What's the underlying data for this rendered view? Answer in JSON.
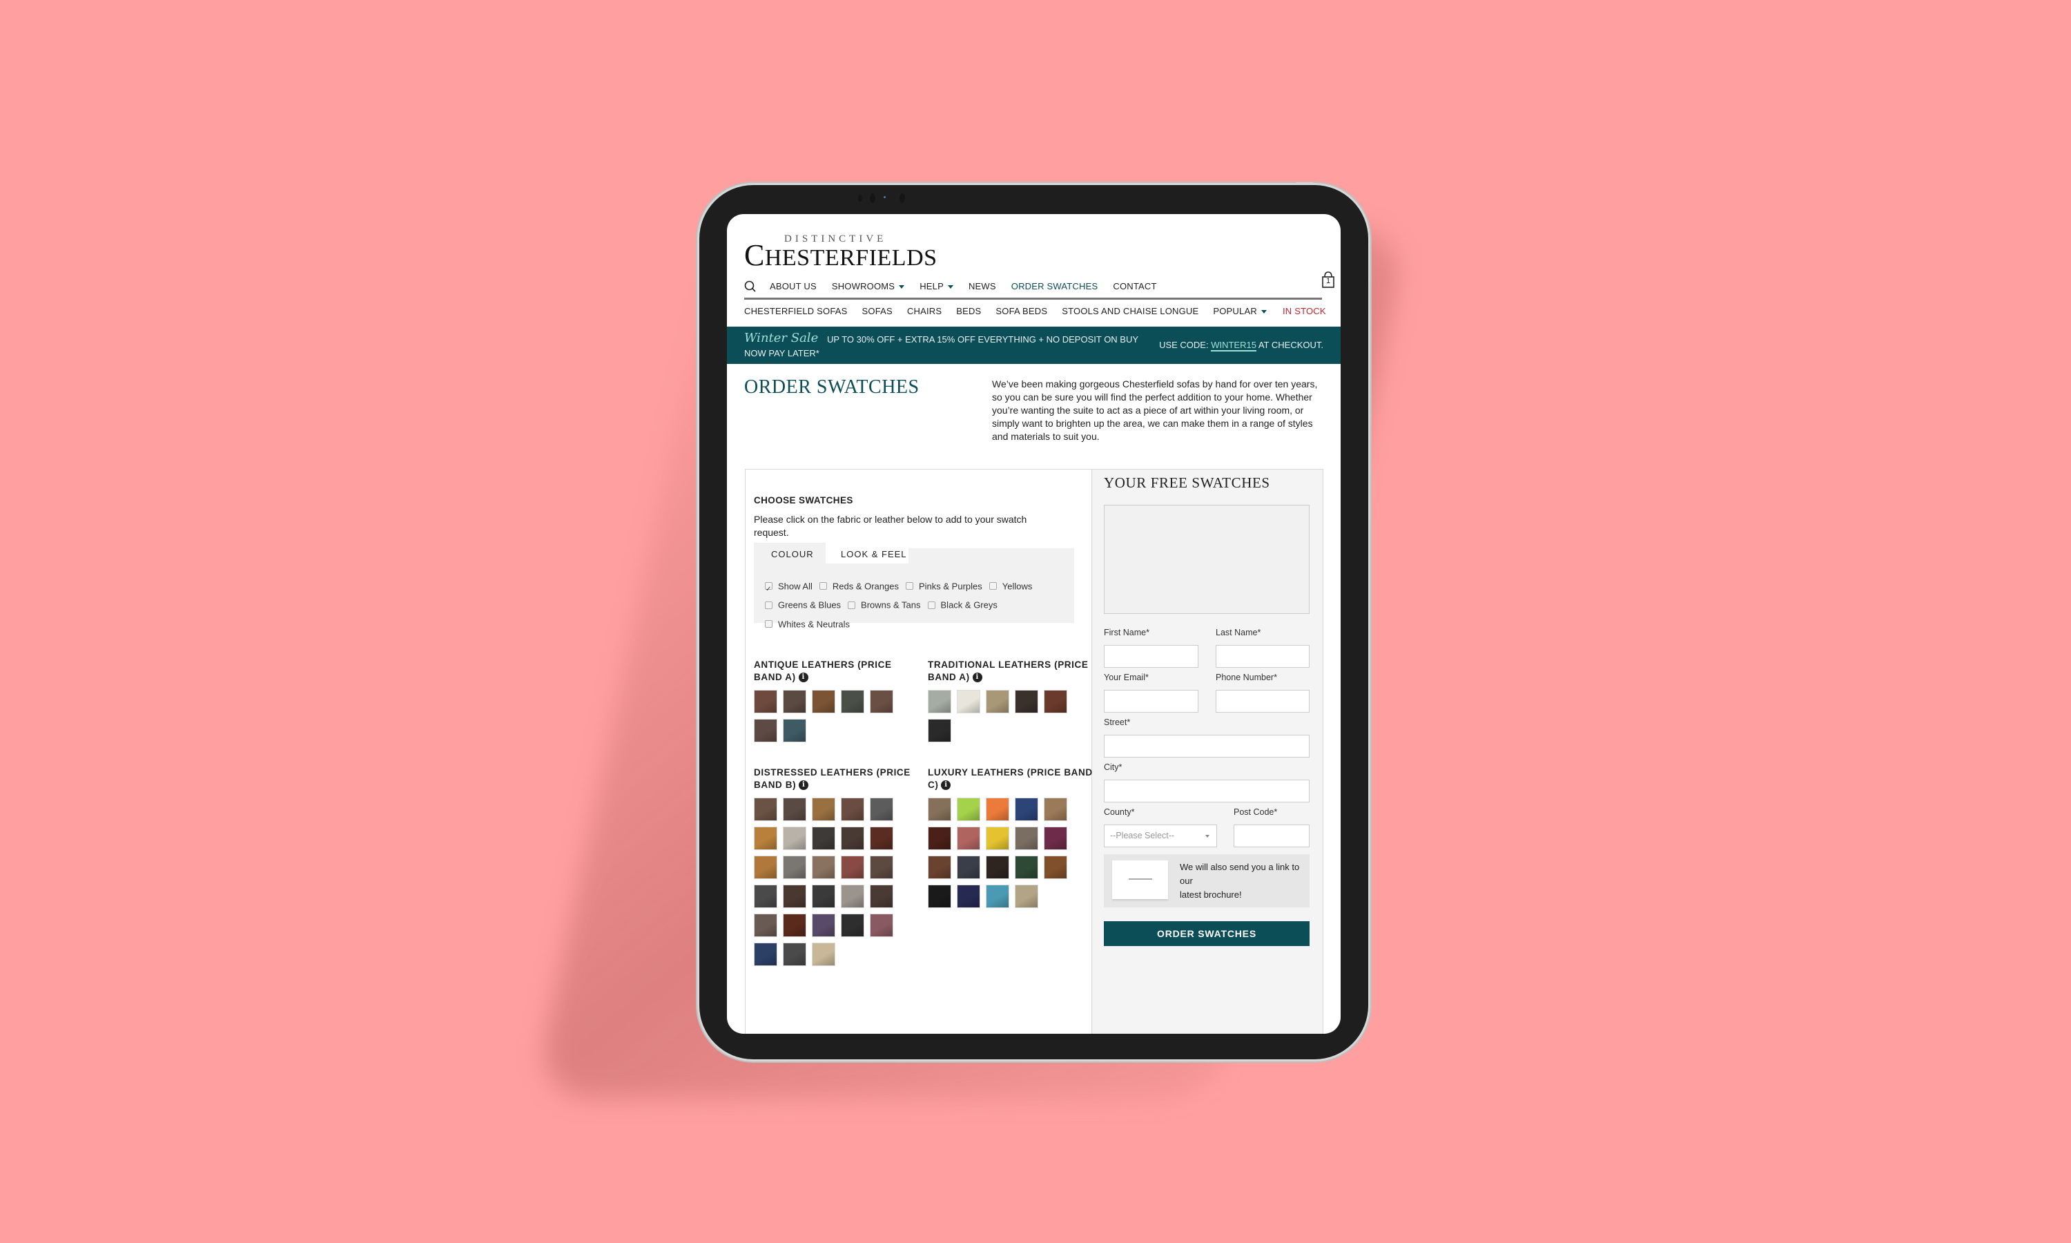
{
  "header": {
    "logo_small": "DISTINCTIVE",
    "logo_cap": "C",
    "logo_rest": "HESTERFIELDS",
    "cart_count": "1",
    "nav_primary": [
      {
        "label": "ABOUT US",
        "dropdown": false
      },
      {
        "label": "SHOWROOMS",
        "dropdown": true
      },
      {
        "label": "HELP",
        "dropdown": true
      },
      {
        "label": "NEWS",
        "dropdown": false
      },
      {
        "label": "ORDER SWATCHES",
        "dropdown": false,
        "active": true
      },
      {
        "label": "CONTACT",
        "dropdown": false
      }
    ],
    "nav_secondary": [
      {
        "label": "CHESTERFIELD SOFAS"
      },
      {
        "label": "SOFAS"
      },
      {
        "label": "CHAIRS"
      },
      {
        "label": "BEDS"
      },
      {
        "label": "SOFA BEDS"
      },
      {
        "label": "STOOLS AND CHAISE LONGUE"
      },
      {
        "label": "POPULAR",
        "dropdown": true
      }
    ],
    "in_stock": "IN STOCK"
  },
  "banner": {
    "script": "Winter Sale",
    "line1": "UP TO 30% OFF + EXTRA 15% OFF EVERYTHING + NO DEPOSIT ON BUY",
    "line2": "NOW PAY LATER*",
    "code_prefix": "USE CODE:",
    "code": "WINTER15",
    "code_suffix": "AT CHECKOUT."
  },
  "page": {
    "title": "ORDER SWATCHES",
    "description": "We’ve been making gorgeous Chesterfield sofas by hand for over ten years, so you can be sure you will find the perfect addition to your home. Whether you’re wanting the suite to act as a piece of art within your living room, or simply want to brighten up the area, we can make them in a range of styles and materials to suit you."
  },
  "choose": {
    "heading": "CHOOSE SWATCHES",
    "instructions": "Please click on the fabric or leather below to add to your swatch request.",
    "tabs": [
      {
        "label": "COLOUR",
        "active": true
      },
      {
        "label": "LOOK & FEEL",
        "active": false
      }
    ],
    "filters": [
      {
        "label": "Show All",
        "checked": true
      },
      {
        "label": "Reds & Oranges",
        "checked": false
      },
      {
        "label": "Pinks & Purples",
        "checked": false
      },
      {
        "label": "Yellows",
        "checked": false
      },
      {
        "label": "Greens & Blues",
        "checked": false
      },
      {
        "label": "Browns & Tans",
        "checked": false
      },
      {
        "label": "Black & Greys",
        "checked": false
      },
      {
        "label": "Whites & Neutrals",
        "checked": false
      }
    ],
    "groups": [
      {
        "title": "ANTIQUE LEATHERS (PRICE BAND A)",
        "swatches": [
          "#6e4a3e",
          "#5a4a42",
          "#7a5434",
          "#4a5048",
          "#6a5044",
          "#5e4a44",
          "#3e5a64"
        ]
      },
      {
        "title": "TRADITIONAL LEATHERS (PRICE BAND A)",
        "swatches": [
          "#a4aca4",
          "#e8e6dc",
          "#a89878",
          "#3a302c",
          "#6a3a2c",
          "#2a2a2a"
        ]
      },
      {
        "title": "DISTRESSED LEATHERS (PRICE BAND B)",
        "swatches": [
          "#6a5244",
          "#5a4a44",
          "#9a7040",
          "#6a4c40",
          "#5c5c5c",
          "#b8803a",
          "#b8b2a8",
          "#3e3a38",
          "#4a3a34",
          "#5a2c22",
          "#b0783a",
          "#7a7672",
          "#8a7260",
          "#8a4a44",
          "#5c4a40",
          "#4a4a4a",
          "#4a3830",
          "#3a3a3a",
          "#9a948c",
          "#4a3a34",
          "#6a5a54",
          "#5a2a1c",
          "#5a4a6a",
          "#2e2e2e",
          "#8a5a62",
          "#2c4066",
          "#4a4a4a",
          "#c8b898"
        ]
      },
      {
        "title": "LUXURY LEATHERS (PRICE BAND C)",
        "swatches": [
          "#86705a",
          "#a4d24a",
          "#ec7a3a",
          "#2c4478",
          "#9a7a58",
          "#4a2018",
          "#b06460",
          "#e4c230",
          "#7a6e62",
          "#6e2c4a",
          "#6a4230",
          "#3a3e48",
          "#2e2420",
          "#2e4a36",
          "#80502a",
          "#1a1a1a",
          "#262a52",
          "#4a9ab4",
          "#b4a486"
        ]
      }
    ]
  },
  "form": {
    "heading": "YOUR FREE SWATCHES",
    "first_name_label": "First Name*",
    "last_name_label": "Last Name*",
    "email_label": "Your Email*",
    "phone_label": "Phone Number*",
    "street_label": "Street*",
    "city_label": "City*",
    "county_label": "County*",
    "county_value": "--Please Select--",
    "postcode_label": "Post Code*",
    "brochure_line1": "We will also send you a link to our",
    "brochure_line2": "latest brochure!",
    "submit_label": "ORDER SWATCHES"
  },
  "colors": {
    "brand_teal": "#0c4e57",
    "in_stock_red": "#c8232c",
    "background": "#ff9f9f"
  }
}
